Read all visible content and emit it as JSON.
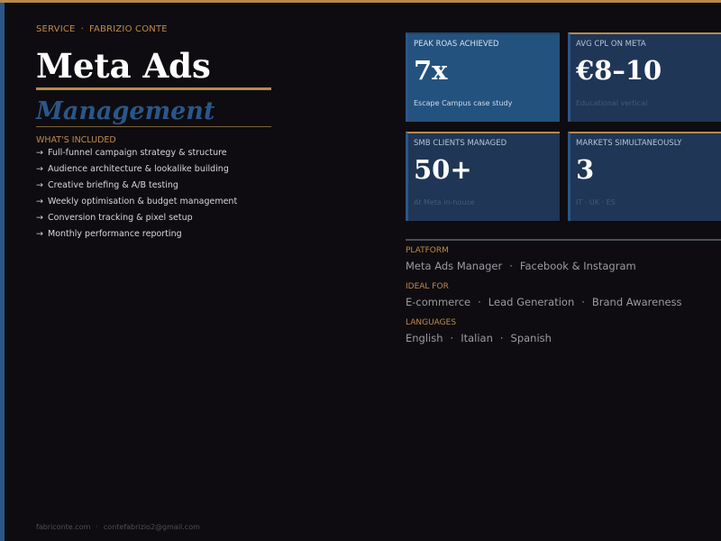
{
  "colors": {
    "accent_gold": "#b88a4a",
    "accent_blue": "#2a5688",
    "background": "#0e0c10"
  },
  "header": {
    "eyebrow_service": "SERVICE",
    "eyebrow_sep": "·",
    "eyebrow_name": "FABRIZIO CONTE"
  },
  "title": "Meta Ads",
  "subtitle": "Management",
  "included": {
    "title": "WHAT'S INCLUDED",
    "arrow": "→",
    "items": [
      "Full-funnel campaign strategy & structure",
      "Audience architecture & lookalike building",
      "Creative briefing & A/B testing",
      "Weekly optimisation & budget management",
      "Conversion tracking & pixel setup",
      "Monthly performance reporting"
    ]
  },
  "stats": [
    {
      "label": "PEAK ROAS ACHIEVED",
      "value": "7x",
      "sub": "Escape Campus case study"
    },
    {
      "label": "AVG CPL ON META",
      "value": "€8–10",
      "sub": "Educational vertical"
    },
    {
      "label": "SMB CLIENTS MANAGED",
      "value": "50+",
      "sub": "At Meta in-house"
    },
    {
      "label": "MARKETS SIMULTANEOUSLY",
      "value": "3",
      "sub": "IT · UK · ES"
    }
  ],
  "info": {
    "sep": "·",
    "platform": {
      "label": "PLATFORM",
      "items": [
        "Meta Ads Manager",
        "Facebook & Instagram"
      ]
    },
    "ideal_for": {
      "label": "IDEAL FOR",
      "items": [
        "E-commerce",
        "Lead Generation",
        "Brand Awareness"
      ]
    },
    "languages": {
      "label": "LANGUAGES",
      "items": [
        "English",
        "Italian",
        "Spanish"
      ]
    }
  },
  "footer": {
    "website": "fabriconte.com",
    "sep": "·",
    "email": "contefabrizio2@gmail.com"
  }
}
